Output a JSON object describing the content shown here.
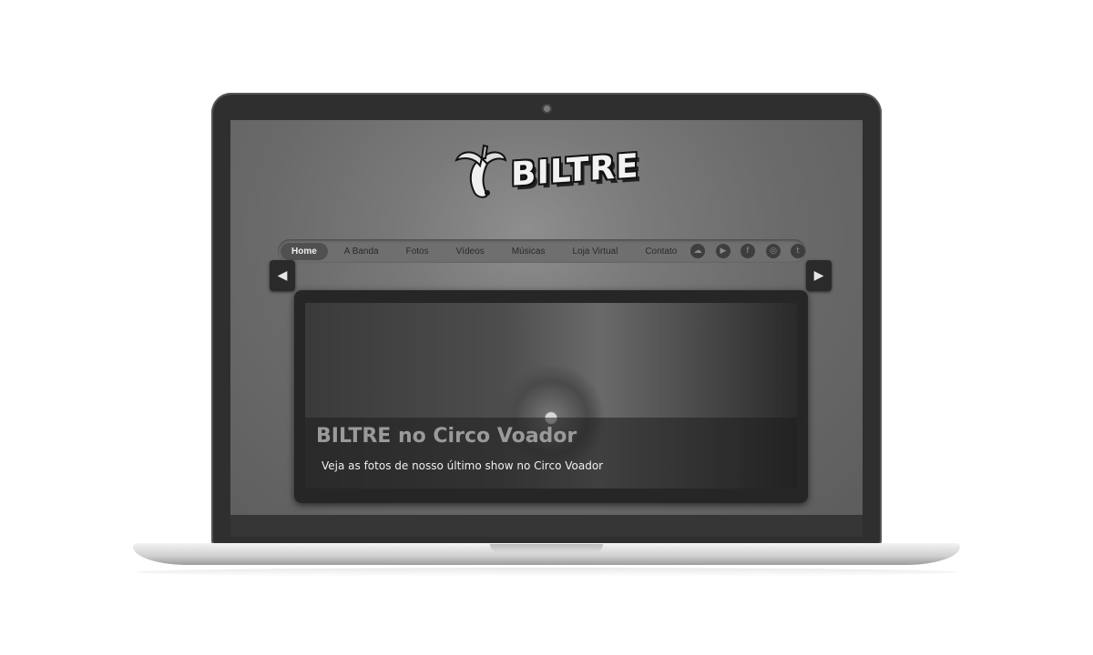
{
  "logo": {
    "text": "BILTRE"
  },
  "nav": {
    "items": [
      {
        "label": "Home",
        "active": true
      },
      {
        "label": "A Banda"
      },
      {
        "label": "Fotos"
      },
      {
        "label": "Vídeos"
      },
      {
        "label": "Músicas"
      },
      {
        "label": "Loja Virtual"
      },
      {
        "label": "Contato"
      }
    ]
  },
  "social": [
    {
      "icon": "soundcloud-icon",
      "glyph": "☁"
    },
    {
      "icon": "youtube-icon",
      "glyph": "▶"
    },
    {
      "icon": "facebook-icon",
      "glyph": "f"
    },
    {
      "icon": "instagram-icon",
      "glyph": "◎"
    },
    {
      "icon": "twitter-icon",
      "glyph": "t"
    }
  ],
  "slider": {
    "title": "BILTRE no Circo Voador",
    "subtitle": "Veja as fotos de nosso último show no Circo Voador",
    "prev_glyph": "◀",
    "next_glyph": "▶"
  }
}
